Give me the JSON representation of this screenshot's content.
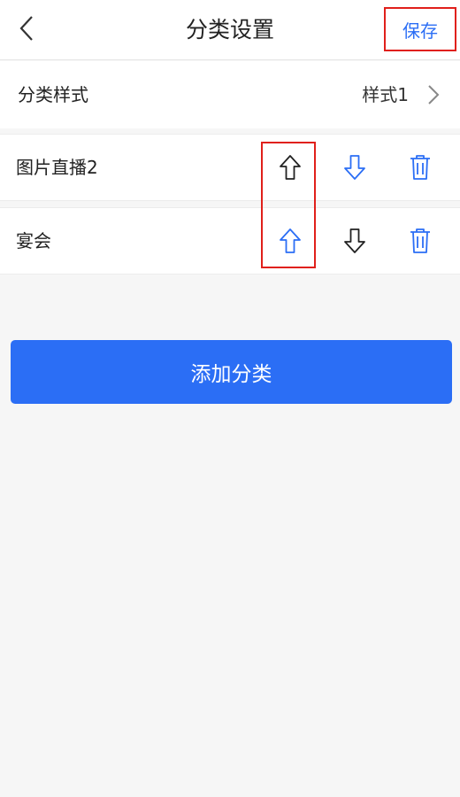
{
  "header": {
    "title": "分类设置",
    "save_label": "保存",
    "back_icon": "chevron-left-icon"
  },
  "style_row": {
    "label": "分类样式",
    "value": "样式1",
    "icon": "chevron-right-icon"
  },
  "categories": [
    {
      "name": "图片直播2",
      "up_color": "#222222",
      "down_color": "#2b6ef5",
      "delete_color": "#2b6ef5"
    },
    {
      "name": "宴会",
      "up_color": "#2b6ef5",
      "down_color": "#222222",
      "delete_color": "#2b6ef5"
    }
  ],
  "add_button": {
    "label": "添加分类"
  },
  "colors": {
    "accent": "#2b6ef5",
    "highlight": "#e0201b",
    "background": "#f6f6f6"
  }
}
